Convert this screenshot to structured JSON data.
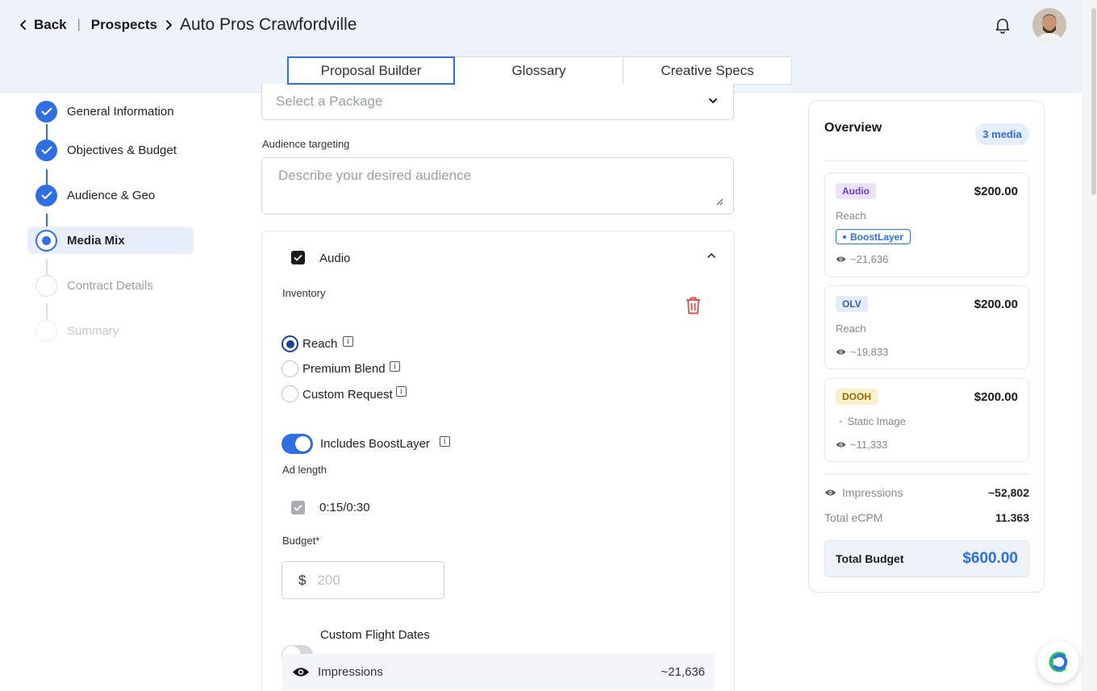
{
  "header": {
    "back_label": "Back",
    "breadcrumb_prospects": "Prospects",
    "current_page": "Auto Pros Crawfordville"
  },
  "tabs": [
    {
      "label": "Proposal Builder",
      "active": true
    },
    {
      "label": "Glossary",
      "active": false
    },
    {
      "label": "Creative Specs",
      "active": false
    }
  ],
  "stepper": [
    {
      "label": "General Information",
      "state": "done"
    },
    {
      "label": "Objectives & Budget",
      "state": "done"
    },
    {
      "label": "Audience & Geo",
      "state": "done"
    },
    {
      "label": "Media Mix",
      "state": "current"
    },
    {
      "label": "Contract Details",
      "state": "todo"
    },
    {
      "label": "Summary",
      "state": "todo"
    }
  ],
  "form": {
    "package_placeholder": "Select a Package",
    "audience_label": "Audience targeting",
    "audience_placeholder": "Describe your desired audience",
    "media": {
      "name": "Audio",
      "checked": true,
      "inventory_label": "Inventory",
      "inventory_options": [
        {
          "label": "Reach",
          "selected": true
        },
        {
          "label": "Premium Blend",
          "selected": false
        },
        {
          "label": "Custom Request",
          "selected": false
        }
      ],
      "boost_label": "Includes BoostLayer",
      "boost_on": true,
      "ad_length_label": "Ad length",
      "ad_length_value": "0:15/0:30",
      "budget_label": "Budget*",
      "budget_currency": "$",
      "budget_placeholder": "200",
      "custom_flight_label": "Custom Flight Dates",
      "custom_flight_on": false,
      "impressions_label": "Impressions",
      "impressions_value": "~21,636"
    }
  },
  "overview": {
    "title": "Overview",
    "badge": "3 media",
    "items": [
      {
        "tag": "Audio",
        "price": "$200.00",
        "sub": "Reach",
        "pill": "BoostLayer",
        "impressions": "~21,636",
        "tag_bg": "#ece3fb",
        "tag_fg": "#6b3fc9"
      },
      {
        "tag": "OLV",
        "price": "$200.00",
        "sub": "Reach",
        "impressions": "~19,833",
        "tag_bg": "#e3ecfb",
        "tag_fg": "#2f5fb8"
      },
      {
        "tag": "DOOH",
        "price": "$200.00",
        "sub": "Static Image",
        "impressions": "~11,333",
        "tag_bg": "#fbf0cc",
        "tag_fg": "#9a6b00"
      }
    ],
    "impressions_label": "Impressions",
    "impressions_total": "~52,802",
    "ecpm_label": "Total eCPM",
    "ecpm_value": "11.363",
    "total_budget_label": "Total Budget",
    "total_budget_value": "$600.00"
  }
}
